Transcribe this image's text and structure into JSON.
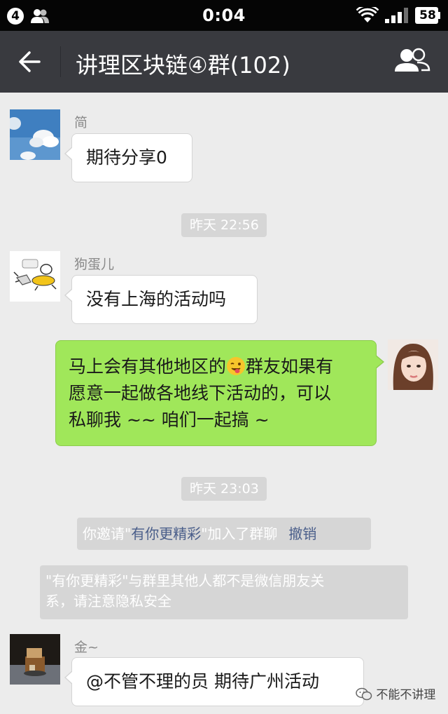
{
  "status_bar": {
    "notification_count": "4",
    "time": "0:04",
    "battery": "58"
  },
  "header": {
    "title": "讲理区块链④群(102)"
  },
  "messages": [
    {
      "sender": "简",
      "text": "期待分享0"
    },
    {
      "sender": "狗蛋儿",
      "text": "没有上海的活动吗"
    },
    {
      "line1_before_emoji": "马上会有其他地区的",
      "emoji": "wink-tongue-emoji",
      "line1_after_emoji": "群友如果有",
      "line2": "愿意一起做各地线下活动的，可以",
      "line3": "私聊我 ~~ 咱们一起搞 ~"
    },
    {
      "sender": "金~",
      "text": "@不管不理的员  期待广州活动"
    }
  ],
  "timestamps": [
    "昨天 22:56",
    "昨天 23:03"
  ],
  "system_messages": {
    "invite_before": "你邀请\"",
    "invite_name": "有你更精彩",
    "invite_after": "\"加入了群聊",
    "invite_action": "撤销",
    "privacy_line1": "\"有你更精彩\"与群里其他人都不是微信朋友关",
    "privacy_line2": "系，请注意隐私安全"
  },
  "watermark": "不能不讲理",
  "colors": {
    "status_bar": "#050505",
    "title_bar": "#393a3f",
    "chat_bg": "#ececec",
    "outgoing_bubble": "#a0e75a",
    "incoming_bubble": "#ffffff",
    "system_pill": "#d6d6d6",
    "link": "#4a5e8a"
  }
}
